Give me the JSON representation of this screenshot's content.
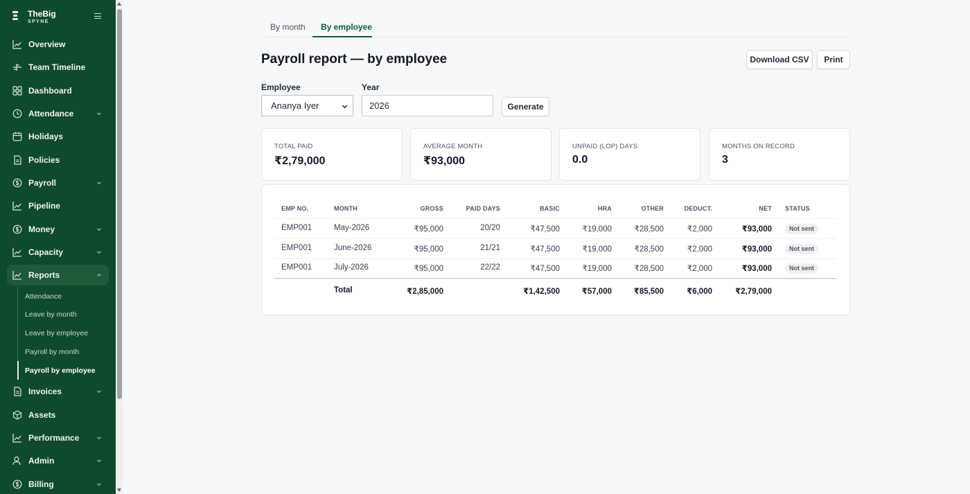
{
  "brand": {
    "name": "TheBig",
    "sub": "SPYNE"
  },
  "sidebar": {
    "items": [
      {
        "label": "Overview",
        "icon": "chart-line-icon",
        "chevron": false
      },
      {
        "label": "Team Timeline",
        "icon": "timeline-icon",
        "chevron": false
      },
      {
        "label": "Dashboard",
        "icon": "grid-icon",
        "chevron": false
      },
      {
        "label": "Attendance",
        "icon": "clock-icon",
        "chevron": true
      },
      {
        "label": "Holidays",
        "icon": "calendar-icon",
        "chevron": false
      },
      {
        "label": "Policies",
        "icon": "document-icon",
        "chevron": false
      },
      {
        "label": "Payroll",
        "icon": "coin-icon",
        "chevron": true
      },
      {
        "label": "Pipeline",
        "icon": "chart-line-icon",
        "chevron": false
      },
      {
        "label": "Money",
        "icon": "coin-icon",
        "chevron": true
      },
      {
        "label": "Capacity",
        "icon": "chart-line-icon",
        "chevron": true
      },
      {
        "label": "Reports",
        "icon": "chart-line-icon",
        "chevron": true,
        "active": true
      },
      {
        "label": "Invoices",
        "icon": "document-icon",
        "chevron": true
      },
      {
        "label": "Assets",
        "icon": "box-icon",
        "chevron": false
      },
      {
        "label": "Performance",
        "icon": "chart-line-icon",
        "chevron": true
      },
      {
        "label": "Admin",
        "icon": "user-icon",
        "chevron": true
      },
      {
        "label": "Billing",
        "icon": "coin-icon",
        "chevron": true
      }
    ],
    "reports_sub": [
      "Attendance",
      "Leave by month",
      "Leave by employee",
      "Payroll by month",
      "Payroll by employee"
    ]
  },
  "tabs": [
    "By month",
    "By employee"
  ],
  "page": {
    "title": "Payroll report — by employee",
    "download_label": "Download CSV",
    "print_label": "Print",
    "employee_label": "Employee",
    "employee_value": "Ananya Iyer",
    "year_label": "Year",
    "year_value": "2026",
    "generate_label": "Generate"
  },
  "stats": [
    {
      "label": "TOTAL PAID",
      "value": "₹2,79,000"
    },
    {
      "label": "AVERAGE MONTH",
      "value": "₹93,000"
    },
    {
      "label": "UNPAID (LOP) DAYS",
      "value": "0.0"
    },
    {
      "label": "MONTHS ON RECORD",
      "value": "3"
    }
  ],
  "table": {
    "headers": [
      "EMP NO.",
      "MONTH",
      "GROSS",
      "PAID DAYS",
      "BASIC",
      "HRA",
      "OTHER",
      "DEDUCT.",
      "NET",
      "STATUS"
    ],
    "rows": [
      [
        "EMP001",
        "May-2026",
        "₹95,000",
        "20/20",
        "₹47,500",
        "₹19,000",
        "₹28,500",
        "₹2,000",
        "₹93,000",
        "Not sent"
      ],
      [
        "EMP001",
        "June-2026",
        "₹95,000",
        "21/21",
        "₹47,500",
        "₹19,000",
        "₹28,500",
        "₹2,000",
        "₹93,000",
        "Not sent"
      ],
      [
        "EMP001",
        "July-2026",
        "₹95,000",
        "22/22",
        "₹47,500",
        "₹19,000",
        "₹28,500",
        "₹2,000",
        "₹93,000",
        "Not sent"
      ]
    ],
    "total": {
      "label": "Total",
      "gross": "₹2,85,000",
      "basic": "₹1,42,500",
      "hra": "₹57,000",
      "other": "₹85,500",
      "deduct": "₹6,000",
      "net": "₹2,79,000"
    }
  },
  "colors": {
    "sidebar": "#0f4a2c",
    "accent": "#0f5b37"
  }
}
